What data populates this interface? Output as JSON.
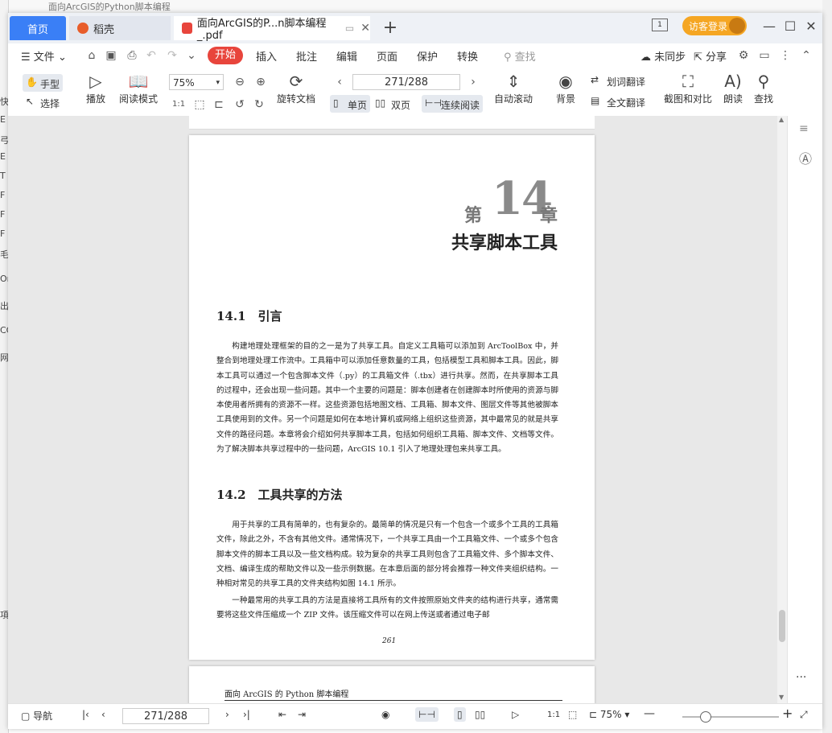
{
  "background": {
    "top_title": "面向ArcGIS的Python脚本编程",
    "left_chars": [
      "快",
      "E",
      "弓",
      "E",
      "T",
      "F",
      "F",
      "F",
      "毛",
      "Or",
      "出",
      "CC",
      "网",
      "項"
    ]
  },
  "tabs": {
    "home": "首页",
    "daoke": "稻壳",
    "doc": "面向ArcGIS的P...n脚本编程_.pdf",
    "plus": "+"
  },
  "titlebar": {
    "login": "访客登录",
    "page_ind": "1"
  },
  "menu": {
    "file": "文件",
    "start": "开始",
    "insert": "插入",
    "annotate": "批注",
    "edit": "编辑",
    "page": "页面",
    "protect": "保护",
    "convert": "转换",
    "search": "查找",
    "unsynced": "未同步",
    "share": "分享"
  },
  "toolbar": {
    "hand": "手型",
    "select": "选择",
    "play": "播放",
    "read_mode": "阅读模式",
    "zoom": "75%",
    "rotate": "旋转文档",
    "page_input": "271/288",
    "single": "单页",
    "double": "双页",
    "continuous": "连续阅读",
    "auto_scroll": "自动滚动",
    "background": "背景",
    "word_translate": "划词翻译",
    "full_translate": "全文翻译",
    "screenshot_compare": "截图和对比",
    "read_aloud": "朗读",
    "find": "查找"
  },
  "document": {
    "chapter_pre": "第",
    "chapter_num": "14",
    "chapter_post": "章",
    "chapter_title": "共享脚本工具",
    "sec1_title": "14.1　引言",
    "sec1_para": "构建地理处理框架的目的之一是为了共享工具。自定义工具箱可以添加到 ArcToolBox 中，并整合到地理处理工作流中。工具箱中可以添加任意数量的工具，包括模型工具和脚本工具。因此，脚本工具可以通过一个包含脚本文件（.py）的工具箱文件（.tbx）进行共享。然而，在共享脚本工具的过程中，还会出现一些问题。其中一个主要的问题是：脚本创建者在创建脚本时所使用的资源与脚本使用者所拥有的资源不一样。这些资源包括地图文档、工具箱、脚本文件、图层文件等其他被脚本工具使用到的文件。另一个问题是如何在本地计算机或网络上组织这些资源，其中最常见的就是共享文件的路径问题。本章将会介绍如何共享脚本工具，包括如何组织工具箱、脚本文件、文档等文件。为了解决脚本共享过程中的一些问题，ArcGIS 10.1 引入了地理处理包来共享工具。",
    "sec2_title": "14.2　工具共享的方法",
    "sec2_para1": "用于共享的工具有简单的，也有复杂的。最简单的情况是只有一个包含一个或多个工具的工具箱文件，除此之外，不含有其他文件。通常情况下，一个共享工具由一个工具箱文件、一个或多个包含脚本文件的脚本工具以及一些文档构成。较为复杂的共享工具则包含了工具箱文件、多个脚本文件、文档、编译生成的帮助文件以及一些示例数据。在本章后面的部分将会推荐一种文件夹组织结构。一种相对常见的共享工具的文件夹结构如图 14.1 所示。",
    "sec2_para2": "一种最常用的共享工具的方法是直接将工具所有的文件按照原始文件夹的结构进行共享，通常需要将这些文件压缩成一个 ZIP 文件。该压缩文件可以在网上传送或者通过电子邮",
    "page_number": "261",
    "next_running_head": "面向 ArcGIS 的 Python 脚本编程"
  },
  "statusbar": {
    "nav": "导航",
    "page": "271/288",
    "zoom": "75%",
    "more": "···"
  },
  "colors": {
    "accent": "#3a7ff6",
    "start_red": "#e8453c",
    "login_orange": "#f5a623"
  }
}
